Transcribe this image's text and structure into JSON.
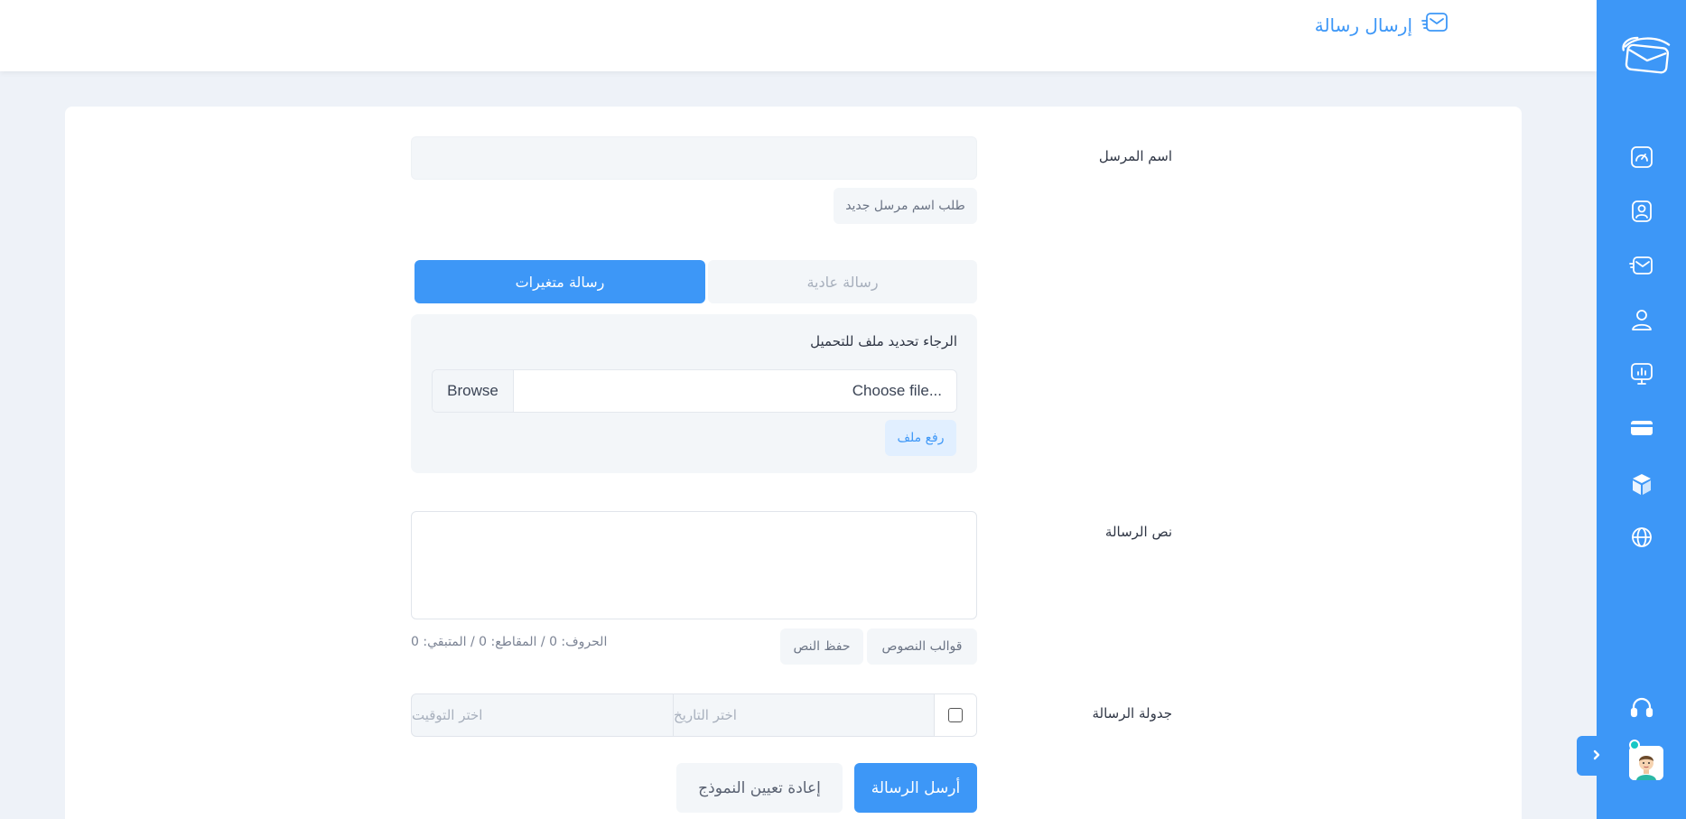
{
  "header": {
    "title": "إرسال رسالة",
    "title_icon": "envelope-lines-icon"
  },
  "colors": {
    "accent": "#3d97f7",
    "background": "#eef2f8",
    "field": "#f3f6f9"
  },
  "sidebar": {
    "logo": "envelope-logo",
    "items": [
      {
        "icon": "dashboard-gauge-icon"
      },
      {
        "icon": "contact-card-icon"
      },
      {
        "icon": "send-mail-icon"
      },
      {
        "icon": "user-icon"
      },
      {
        "icon": "presentation-chart-icon"
      },
      {
        "icon": "credit-card-icon"
      },
      {
        "icon": "box-icon"
      },
      {
        "icon": "globe-icon"
      }
    ],
    "support_icon": "headset-icon",
    "avatar": "user-avatar",
    "collapse_icon": "chevron-right-icon"
  },
  "form": {
    "sender_name_label": "اسم المرسل",
    "sender_name_value": "",
    "request_sender_button": "طلب اسم مرسل جديد",
    "tabs": {
      "normal": "رسالة عادية",
      "variables": "رسالة متغيرات",
      "active": "variables"
    },
    "upload": {
      "instruction": "الرجاء تحديد ملف للتحميل",
      "file_placeholder": "Choose file...",
      "browse_label": "Browse",
      "upload_button": "رفع ملف"
    },
    "message_text_label": "نص الرسالة",
    "message_text_value": "",
    "text_templates_button": "قوالب النصوص",
    "save_text_button": "حفظ النص",
    "counter": "الحروف: 0 / المقاطع: 0 / المتبقي: 0",
    "schedule_label": "جدولة الرسالة",
    "schedule_checked": false,
    "date_placeholder": "اختر التاريخ",
    "time_placeholder": "اختر التوقيت",
    "send_button": "أرسل الرسالة",
    "reset_button": "إعادة تعيين النموذج"
  }
}
